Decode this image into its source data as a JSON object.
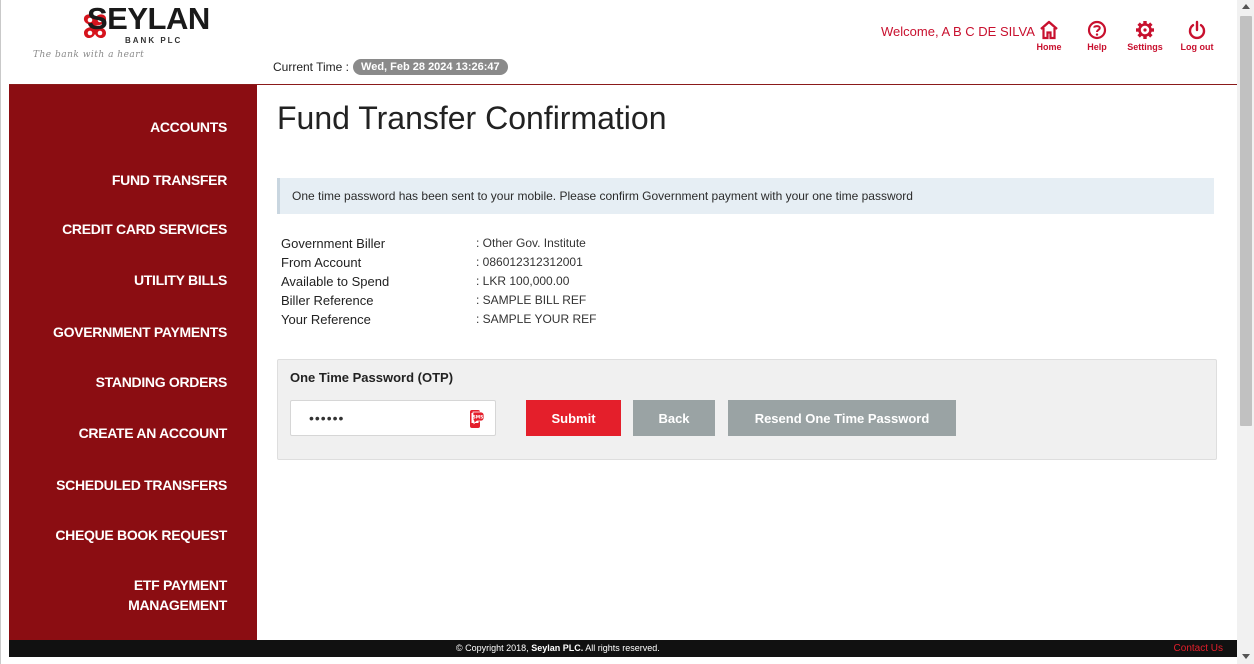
{
  "brand": {
    "name": "SEYLAN",
    "sub": "BANK PLC",
    "tagline": "The bank with a heart",
    "color": "#8b0d12",
    "accent": "#e41f2b"
  },
  "header": {
    "time_label": "Current Time :",
    "time_value": "Wed, Feb 28 2024 13:26:47",
    "welcome": "Welcome, A B C DE SILVA",
    "icons": {
      "home": "Home",
      "help": "Help",
      "settings": "Settings",
      "logout": "Log out"
    }
  },
  "sidebar": {
    "items": [
      {
        "label": "ACCOUNTS"
      },
      {
        "label": "FUND TRANSFER"
      },
      {
        "label": "CREDIT CARD SERVICES"
      },
      {
        "label": "UTILITY BILLS"
      },
      {
        "label": "GOVERNMENT PAYMENTS"
      },
      {
        "label": "STANDING ORDERS"
      },
      {
        "label": "CREATE AN ACCOUNT"
      },
      {
        "label": "SCHEDULED TRANSFERS"
      },
      {
        "label": "CHEQUE BOOK REQUEST"
      },
      {
        "label_line1": "ETF PAYMENT",
        "label_line2": "MANAGEMENT"
      }
    ]
  },
  "main": {
    "title": "Fund Transfer Confirmation",
    "alert": "One time password has been sent to your mobile. Please confirm Government payment with your one time password",
    "details": [
      {
        "label": "Government Biller",
        "value": ": Other Gov. Institute"
      },
      {
        "label": "From Account",
        "value": ": 086012312312001"
      },
      {
        "label": "Available to Spend",
        "value": ": LKR 100,000.00"
      },
      {
        "label": "Biller Reference",
        "value": ": SAMPLE BILL REF"
      },
      {
        "label": "Your Reference",
        "value": ": SAMPLE YOUR REF"
      }
    ],
    "otp": {
      "title": "One Time Password (OTP)",
      "value": "••••••",
      "submit": "Submit",
      "back": "Back",
      "resend": "Resend One Time Password"
    }
  },
  "footer": {
    "copy_prefix": "© Copyright 2018, ",
    "copy_brand": "Seylan PLC.",
    "copy_suffix": " All rights reserved.",
    "contact": "Contact Us"
  }
}
